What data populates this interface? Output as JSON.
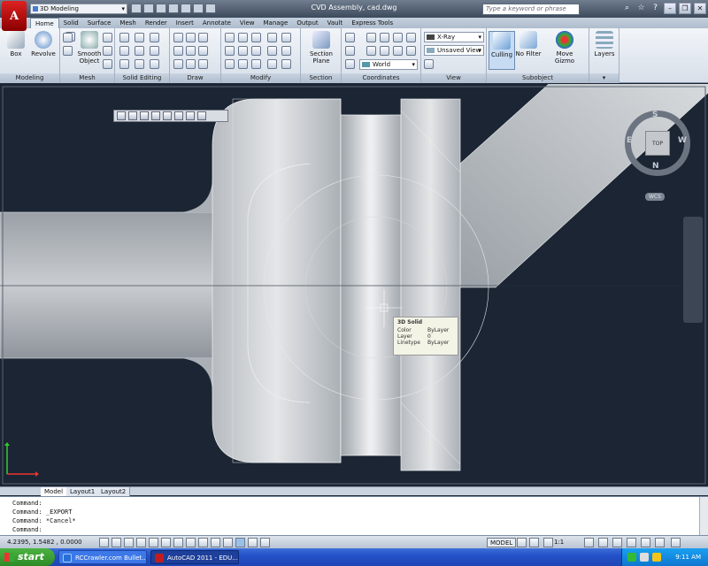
{
  "title_bar": {
    "app_button_label": "A",
    "workspace": "3D Modeling",
    "document_title": "CVD Assembly, cad.dwg",
    "search_placeholder": "Type a keyword or phrase"
  },
  "ribbon_tabs": [
    "Home",
    "Solid",
    "Surface",
    "Mesh",
    "Render",
    "Insert",
    "Annotate",
    "View",
    "Manage",
    "Output",
    "Vault",
    "Express Tools"
  ],
  "active_tab": "Home",
  "panels": {
    "modeling": {
      "label": "Modeling",
      "box": "Box",
      "revolve": "Revolve"
    },
    "mesh": {
      "label": "Mesh",
      "smooth_object": "Smooth Object"
    },
    "solid_editing": {
      "label": "Solid Editing"
    },
    "draw": {
      "label": "Draw"
    },
    "modify": {
      "label": "Modify"
    },
    "section": {
      "label": "Section",
      "section_plane": "Section Plane"
    },
    "coordinates": {
      "label": "Coordinates",
      "ucs": "World"
    },
    "view": {
      "label": "View",
      "visual_style": "X-Ray",
      "named_view": "Unsaved View"
    },
    "subobject": {
      "label": "Subobject",
      "culling": "Culling",
      "no_filter": "No Filter",
      "move_gizmo": "Move Gizmo"
    },
    "layers": {
      "label": "Layers"
    }
  },
  "viewcube": {
    "top": "TOP",
    "north": "N",
    "south": "S",
    "east": "E",
    "west": "W",
    "wcs": "WCS"
  },
  "tooltip": {
    "title": "3D Solid",
    "color_label": "Color",
    "color_value": "ByLayer",
    "layer_label": "Layer",
    "layer_value": "0",
    "linetype_label": "Linetype",
    "linetype_value": "ByLayer"
  },
  "layout_tabs": [
    "Model",
    "Layout1",
    "Layout2"
  ],
  "command_history": [
    "Command:",
    "Command: _EXPORT",
    "Command: *Cancel*",
    "Command:"
  ],
  "status": {
    "coordinates": "4.2395, 1.5482 , 0.0000",
    "model": "MODEL",
    "annotation_scale": "1:1"
  },
  "taskbar": {
    "start": "start",
    "tasks": [
      "RCCrawler.com Bullet...",
      "AutoCAD 2011 - EDU..."
    ],
    "clock": "9:11 AM"
  },
  "colors": {
    "viewport_bg": "#1b2533",
    "ribbon_bg": "#dde4ec",
    "taskbar": "#2452c8",
    "app_red": "#c21d1d"
  }
}
